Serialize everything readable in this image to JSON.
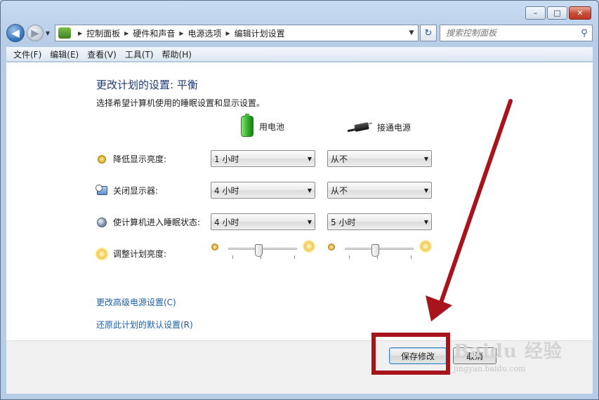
{
  "window": {
    "caption": {
      "minimize": "–",
      "maximize": "□",
      "close": "✕"
    }
  },
  "nav": {
    "back": "◀",
    "forward": "▶",
    "dropdown": "▼",
    "breadcrumbs": [
      "控制面板",
      "硬件和声音",
      "电源选项",
      "编辑计划设置"
    ],
    "separator": "▶",
    "refresh": "↻",
    "search_placeholder": "搜索控制面板"
  },
  "menu": [
    "文件(F)",
    "编辑(E)",
    "查看(V)",
    "工具(T)",
    "帮助(H)"
  ],
  "content": {
    "title": "更改计划的设置: 平衡",
    "subtitle": "选择希望计算机使用的睡眠设置和显示设置。",
    "columns": {
      "battery": "用电池",
      "plugged": "接通电源"
    },
    "rows": [
      {
        "label": "降低显示亮度:",
        "icon": "dim-display-icon",
        "battery": "1 小时",
        "plugged": "从不"
      },
      {
        "label": "关闭显示器:",
        "icon": "monitor-off-icon",
        "battery": "4 小时",
        "plugged": "从不"
      },
      {
        "label": "使计算机进入睡眠状态:",
        "icon": "sleep-moon-icon",
        "battery": "4 小时",
        "plugged": "5 小时"
      }
    ],
    "brightness": {
      "label": "调整计划亮度:",
      "battery_level": 0.43,
      "plugged_level": 0.43
    },
    "links": {
      "advanced": "更改高级电源设置(C)",
      "restore": "还原此计划的默认设置(R)"
    },
    "buttons": {
      "save": "保存修改",
      "cancel": "取消"
    }
  },
  "annotation": {
    "color": "#a8141c"
  },
  "watermark": {
    "logo": "Baidu 经验",
    "url": "jingyan.baidu.com"
  }
}
